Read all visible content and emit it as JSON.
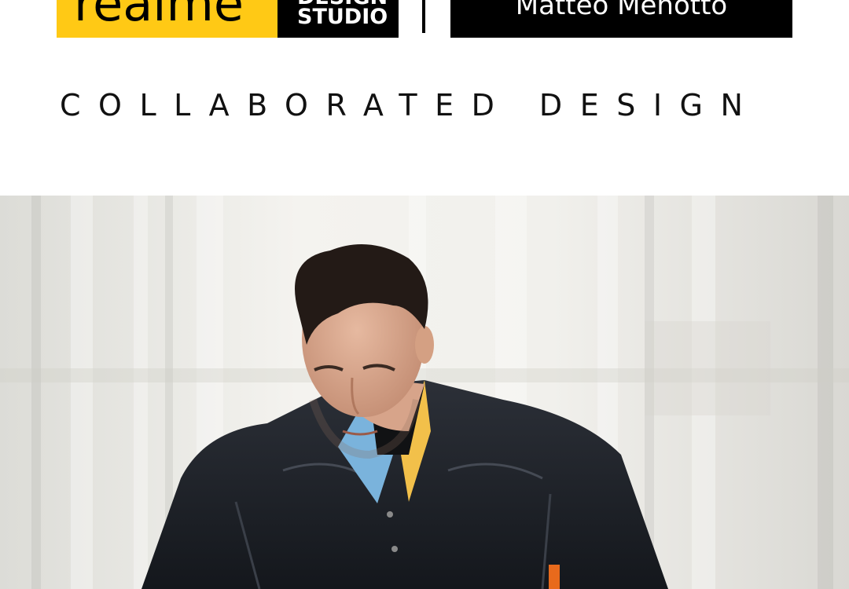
{
  "header": {
    "brand_logo_text": "realme",
    "studio_logo_line1": "DESIGN",
    "studio_logo_line2": "STUDIO",
    "designer_logo_text": "Matteo Menotto"
  },
  "tagline": "COLLABORATED DESIGN",
  "hero": {
    "image": "portrait-photo"
  },
  "colors": {
    "brand_yellow": "#ffc915",
    "black": "#000000",
    "background": "#ffffff"
  }
}
